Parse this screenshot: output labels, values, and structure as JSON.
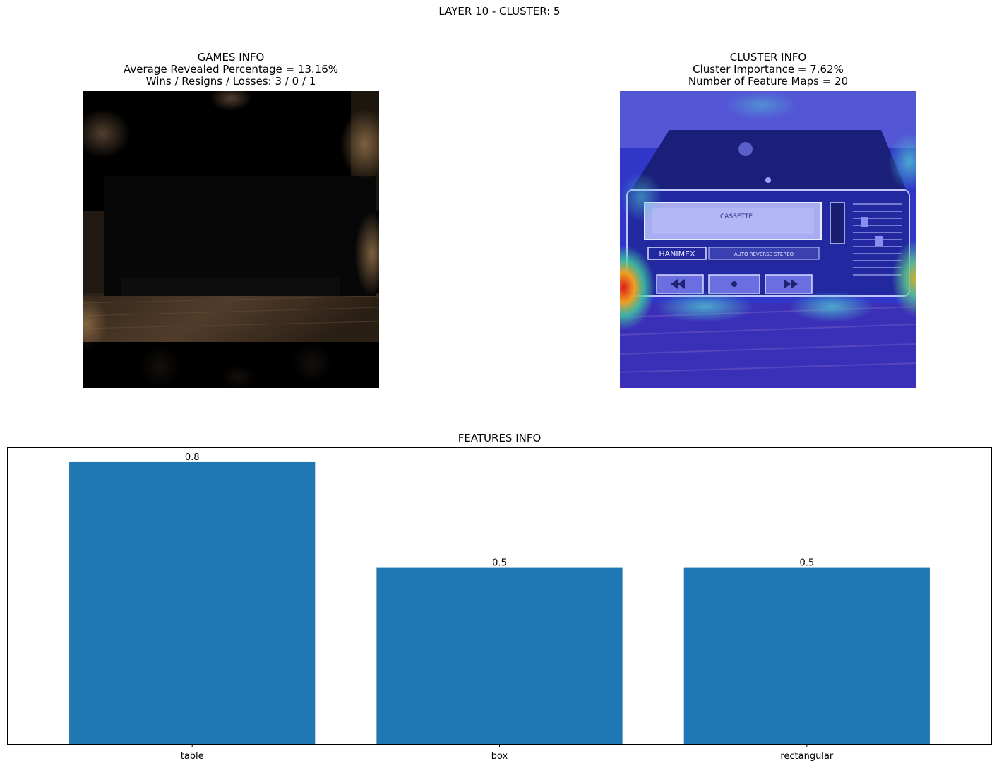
{
  "figure": {
    "suptitle": "LAYER 10 - CLUSTER: 5"
  },
  "games_panel": {
    "title": "GAMES INFO",
    "line1": "Average Revealed Percentage = 13.16%",
    "line2": "Wins / Resigns / Losses: 3 / 0 / 1"
  },
  "cluster_panel": {
    "title": "CLUSTER INFO",
    "line1": "Cluster Importance = 7.62%",
    "line2": "Number of Feature Maps = 20"
  },
  "device_labels": {
    "cassette": "CASSETTE",
    "brand": "HANIMEX",
    "mode": "AUTO REVERSE STEREO"
  },
  "chart_data": {
    "type": "bar",
    "title": "FEATURES INFO",
    "categories": [
      "table",
      "box",
      "rectangular"
    ],
    "values": [
      0.8,
      0.5,
      0.5
    ],
    "data_labels": [
      "0.8",
      "0.5",
      "0.5"
    ],
    "ylim": [
      0,
      0.84
    ],
    "y_axis_visible": false,
    "grid": false,
    "bar_color": "#1f77b4"
  }
}
